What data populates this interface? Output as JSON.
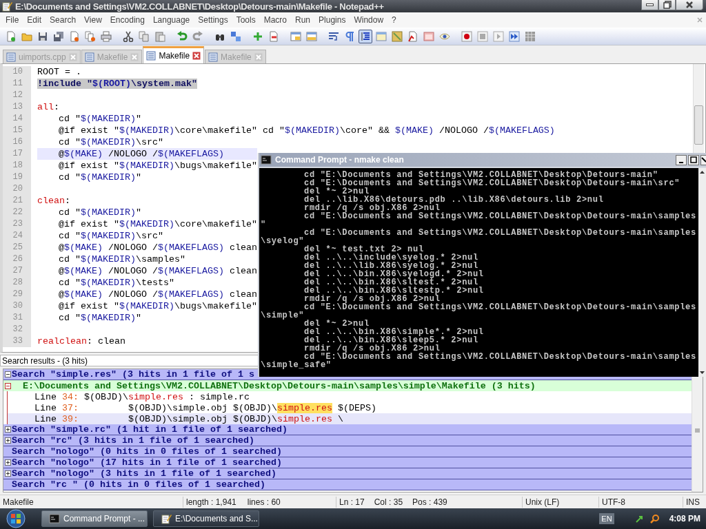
{
  "window": {
    "title": "E:\\Documents and Settings\\VM2.COLLABNET\\Desktop\\Detours-main\\Makefile - Notepad++"
  },
  "menu": [
    "File",
    "Edit",
    "Search",
    "View",
    "Encoding",
    "Language",
    "Settings",
    "Tools",
    "Macro",
    "Run",
    "Plugins",
    "Window",
    "?"
  ],
  "toolbar": [
    {
      "pressed": false
    },
    {
      "pressed": false
    },
    {
      "pressed": false
    },
    {
      "pressed": false
    },
    {
      "pressed": false
    },
    {
      "pressed": false
    },
    {
      "pressed": false
    },
    {
      "pressed": false
    },
    {
      "pressed": false
    },
    {
      "pressed": false
    },
    {
      "pressed": false
    },
    {
      "pressed": false
    },
    {
      "pressed": false
    },
    {
      "pressed": false
    },
    {
      "pressed": false
    },
    {
      "pressed": false
    },
    {
      "pressed": false
    },
    {
      "pressed": false
    },
    {
      "pressed": false
    },
    {
      "pressed": false
    },
    {
      "pressed": true
    },
    {
      "pressed": false
    },
    {
      "pressed": false
    },
    {
      "pressed": false
    },
    {
      "pressed": false
    },
    {
      "pressed": false
    },
    {
      "pressed": false
    },
    {
      "pressed": false
    },
    {
      "pressed": false
    },
    {
      "pressed": false
    },
    {
      "pressed": false
    }
  ],
  "tabs": [
    {
      "label": "uimports.cpp",
      "selected": false
    },
    {
      "label": "Makefile",
      "selected": false
    },
    {
      "label": "Makefile",
      "selected": true
    },
    {
      "label": "Makefile",
      "selected": false
    }
  ],
  "editor": {
    "lines": [
      {
        "number": "10",
        "kind": "command",
        "text": "ROOT = .",
        "indent": false,
        "current": false,
        "marked": false
      },
      {
        "number": "11",
        "kind": "directive",
        "text": "!include \"$(ROOT)\\system.mak\"",
        "indent": false,
        "current": false,
        "marked": true
      },
      {
        "number": "12",
        "kind": "blank",
        "current": false
      },
      {
        "number": "13",
        "kind": "target",
        "name": "all",
        "text": ":",
        "indent": false,
        "current": false,
        "marked": false
      },
      {
        "number": "14",
        "kind": "command",
        "text": "cd \"$(MAKEDIR)\"",
        "indent": true,
        "current": false,
        "marked": false
      },
      {
        "number": "15",
        "kind": "command",
        "text": "@if exist \"$(MAKEDIR)\\core\\makefile\" cd \"$(MAKEDIR)\\core\" && $(MAKE) /NOLOGO /$(MAKEFLAGS)",
        "indent": true,
        "current": false,
        "marked": false
      },
      {
        "number": "16",
        "kind": "command",
        "text": "cd \"$(MAKEDIR)\\src\"",
        "indent": true,
        "current": false,
        "marked": false
      },
      {
        "number": "17",
        "kind": "command",
        "text": "@$(MAKE) /NOLOGO /$(MAKEFLAGS)",
        "indent": true,
        "current": true,
        "marked": false
      },
      {
        "number": "18",
        "kind": "command",
        "text": "@if exist \"$(MAKEDIR)\\bugs\\makefile\"",
        "indent": true,
        "current": false,
        "marked": false
      },
      {
        "number": "19",
        "kind": "command",
        "text": "cd \"$(MAKEDIR)\"",
        "indent": true,
        "current": false,
        "marked": false
      },
      {
        "number": "20",
        "kind": "blank",
        "current": false
      },
      {
        "number": "21",
        "kind": "target",
        "name": "clean",
        "text": ":",
        "indent": false,
        "current": false,
        "marked": false
      },
      {
        "number": "22",
        "kind": "command",
        "text": "cd \"$(MAKEDIR)\"",
        "indent": true,
        "current": false,
        "marked": false
      },
      {
        "number": "23",
        "kind": "command",
        "text": "@if exist \"$(MAKEDIR)\\core\\makefile\"",
        "indent": true,
        "current": false,
        "marked": false
      },
      {
        "number": "24",
        "kind": "command",
        "text": "cd \"$(MAKEDIR)\\src\"",
        "indent": true,
        "current": false,
        "marked": false
      },
      {
        "number": "25",
        "kind": "command",
        "text": "@$(MAKE) /NOLOGO /$(MAKEFLAGS) clean",
        "indent": true,
        "current": false,
        "marked": false
      },
      {
        "number": "26",
        "kind": "command",
        "text": "cd \"$(MAKEDIR)\\samples\"",
        "indent": true,
        "current": false,
        "marked": false
      },
      {
        "number": "27",
        "kind": "command",
        "text": "@$(MAKE) /NOLOGO /$(MAKEFLAGS) clean",
        "indent": true,
        "current": false,
        "marked": false
      },
      {
        "number": "28",
        "kind": "command",
        "text": "cd \"$(MAKEDIR)\\tests\"",
        "indent": true,
        "current": false,
        "marked": false
      },
      {
        "number": "29",
        "kind": "command",
        "text": "@$(MAKE) /NOLOGO /$(MAKEFLAGS) clean",
        "indent": true,
        "current": false,
        "marked": false
      },
      {
        "number": "30",
        "kind": "command",
        "text": "@if exist \"$(MAKEDIR)\\bugs\\makefile\"",
        "indent": true,
        "current": false,
        "marked": false
      },
      {
        "number": "31",
        "kind": "command",
        "text": "cd \"$(MAKEDIR)\"",
        "indent": true,
        "current": false,
        "marked": false
      },
      {
        "number": "32",
        "kind": "blank",
        "current": false
      },
      {
        "number": "33",
        "kind": "target",
        "name": "realclean",
        "text": ": clean",
        "indent": false,
        "current": false,
        "marked": false
      }
    ]
  },
  "console_window": {
    "title": "Command Prompt - nmake clean",
    "lines": [
      {
        "kind": "command",
        "text": "cd \"E:\\Documents and Settings\\VM2.COLLABNET\\Desktop\\Detours-main\""
      },
      {
        "kind": "command",
        "text": "cd \"E:\\Documents and Settings\\VM2.COLLABNET\\Desktop\\Detours-main\\src\""
      },
      {
        "kind": "command",
        "text": "del *~ 2>nul"
      },
      {
        "kind": "command",
        "text": "del ..\\lib.X86\\detours.pdb ..\\lib.X86\\detours.lib 2>nul"
      },
      {
        "kind": "command",
        "text": "rmdir /q /s obj.X86 2>nul"
      },
      {
        "kind": "command",
        "text": "cd \"E:\\Documents and Settings\\VM2.COLLABNET\\Desktop\\Detours-main\\samples"
      },
      {
        "kind": "wrap",
        "text": "\""
      },
      {
        "kind": "command",
        "text": "cd \"E:\\Documents and Settings\\VM2.COLLABNET\\Desktop\\Detours-main\\samples"
      },
      {
        "kind": "wrap",
        "text": "\\syelog\""
      },
      {
        "kind": "command",
        "text": "del *~ test.txt 2> nul"
      },
      {
        "kind": "command",
        "text": "del ..\\..\\include\\syelog.* 2>nul"
      },
      {
        "kind": "command",
        "text": "del ..\\..\\lib.X86\\syelog.* 2>nul"
      },
      {
        "kind": "command",
        "text": "del ..\\..\\bin.X86\\syelogd.* 2>nul"
      },
      {
        "kind": "command",
        "text": "del ..\\..\\bin.X86\\sltest.* 2>nul"
      },
      {
        "kind": "command",
        "text": "del ..\\..\\bin.X86\\sltestp.* 2>nul"
      },
      {
        "kind": "command",
        "text": "rmdir /q /s obj.X86 2>nul"
      },
      {
        "kind": "command",
        "text": "cd \"E:\\Documents and Settings\\VM2.COLLABNET\\Desktop\\Detours-main\\samples"
      },
      {
        "kind": "wrap",
        "text": "\\simple\""
      },
      {
        "kind": "command",
        "text": "del *~ 2>nul"
      },
      {
        "kind": "command",
        "text": "del ..\\..\\bin.X86\\simple*.* 2>nul"
      },
      {
        "kind": "command",
        "text": "del ..\\..\\bin.X86\\sleep5.* 2>nul"
      },
      {
        "kind": "command",
        "text": "rmdir /q /s obj.X86 2>nul"
      },
      {
        "kind": "command",
        "text": "cd \"E:\\Documents and Settings\\VM2.COLLABNET\\Desktop\\Detours-main\\samples"
      },
      {
        "kind": "wrap",
        "text": "\\simple_safe\""
      }
    ]
  },
  "search_results": {
    "title": "Search results - (3 hits)",
    "groups": [
      {
        "label": "Search \"simple.res\" (3 hits in 1 file of 1 s",
        "kind": "expandable",
        "expanded": true,
        "files": [
          {
            "path": "E:\\Documents and Settings\\VM2.COLLABNET\\Desktop\\Detours-main\\samples\\simple\\Makefile (3 hits)",
            "expanded": true,
            "hits": [
              {
                "label": "Line",
                "number": "34:",
                "indented": false,
                "before": "$(OBJD)\\",
                "match": "simple.res",
                "after": " : simple.rc",
                "match_marked": false,
                "selected": false
              },
              {
                "label": "Line",
                "number": "37:",
                "indented": true,
                "before": "$(OBJD)\\simple.obj $(OBJD)\\",
                "match": "simple.res",
                "after": " $(DEPS)",
                "match_marked": true,
                "selected": false
              },
              {
                "label": "Line",
                "number": "39:",
                "indented": true,
                "before": "$(OBJD)\\simple.obj $(OBJD)\\",
                "match": "simple.res",
                "after": " \\",
                "match_marked": false,
                "selected": true
              }
            ]
          }
        ]
      },
      {
        "label": "Search \"simple.rc\" (1 hit in 1 file of 1 searched)",
        "kind": "expandable",
        "expanded": false
      },
      {
        "label": "Search \"rc\" (3 hits in 1 file of 1 searched)",
        "kind": "expandable",
        "expanded": false
      },
      {
        "label": "Search \"nologo\" (0 hits in 0 files of 1 searched)",
        "kind": "empty"
      },
      {
        "label": "Search \"nologo\" (17 hits in 1 file of 1 searched)",
        "kind": "expandable",
        "expanded": false
      },
      {
        "label": "Search \"nologo\" (3 hits in 1 file of 1 searched)",
        "kind": "expandable",
        "expanded": false
      },
      {
        "label": "Search \"rc \" (0 hits in 0 files of 1 searched)",
        "kind": "empty"
      }
    ]
  },
  "status_bar": {
    "file_type": "Makefile",
    "length": "length : 1,941",
    "lines": "lines : 60",
    "line": "Ln : 17",
    "column": "Col : 35",
    "position": "Pos : 439",
    "eol": "Unix (LF)",
    "encoding": "UTF-8",
    "mode": "INS"
  },
  "taskbar": {
    "tasks": [
      {
        "label": "Command Prompt - ...",
        "kind": "console",
        "selected": true
      },
      {
        "label": "E:\\Documents and S...",
        "kind": "notepad",
        "selected": false
      }
    ],
    "language": "EN",
    "clock": "4:08 PM"
  }
}
